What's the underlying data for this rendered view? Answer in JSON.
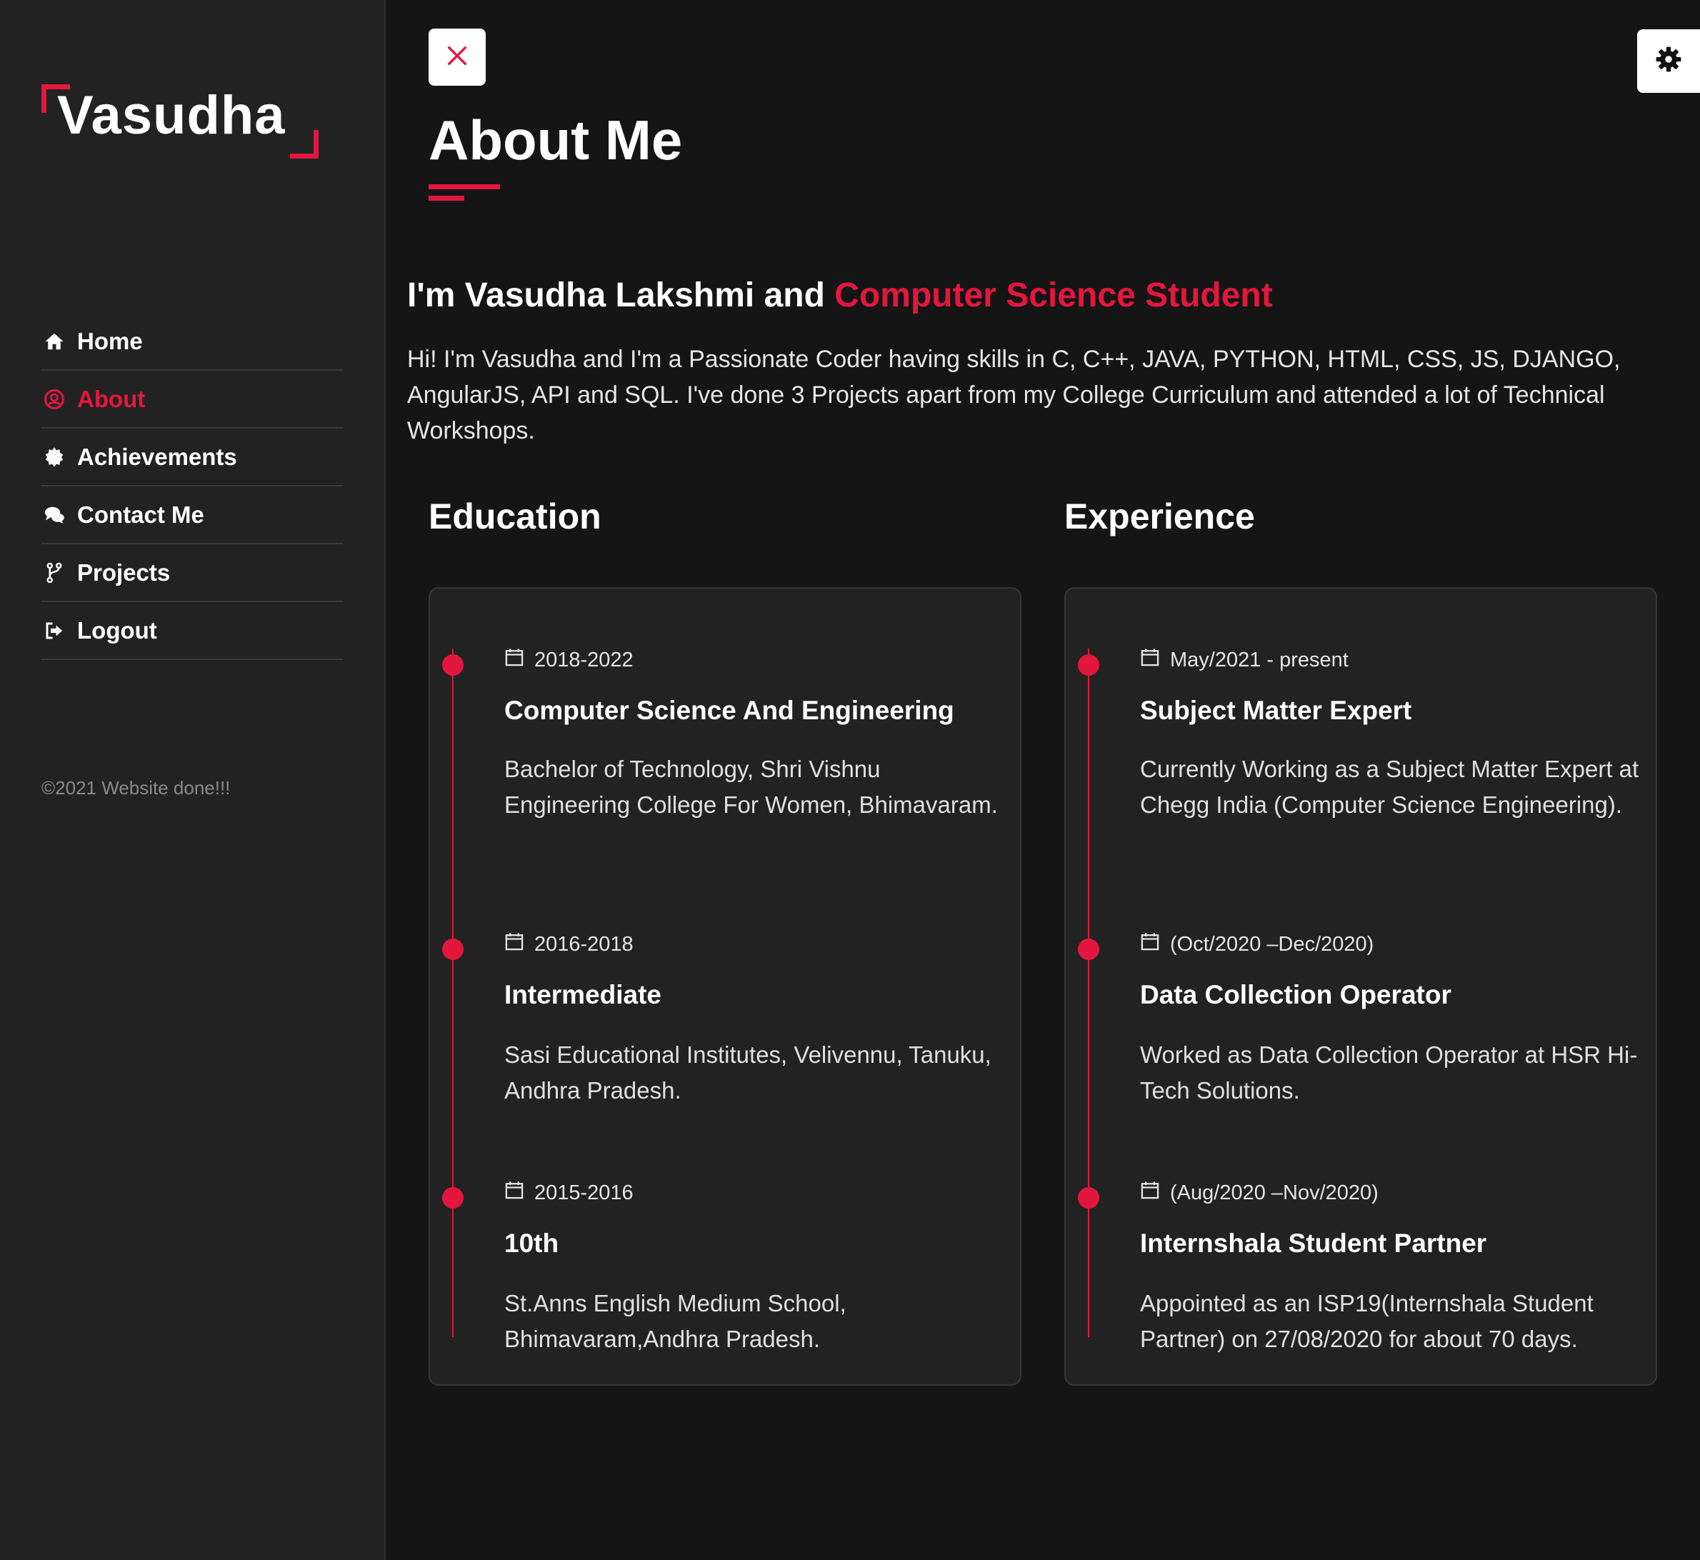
{
  "sidebar": {
    "logo": "Vasudha",
    "nav": [
      {
        "label": "Home",
        "icon": "home-icon"
      },
      {
        "label": "About",
        "icon": "user-circle-icon",
        "active": true
      },
      {
        "label": "Achievements",
        "icon": "badge-icon"
      },
      {
        "label": "Contact Me",
        "icon": "chat-icon"
      },
      {
        "label": "Projects",
        "icon": "code-fork-icon"
      },
      {
        "label": "Logout",
        "icon": "sign-out-icon"
      }
    ],
    "copyright": "©2021 Website done!!!"
  },
  "header": {
    "close_icon": "close-icon",
    "settings_icon": "gear-icon",
    "title": "About Me"
  },
  "intro": {
    "heading_prefix": "I'm Vasudha Lakshmi and",
    "heading_accent": "Computer Science Student",
    "text": "Hi! I'm Vasudha and I'm a Passionate Coder having skills in C, C++, JAVA, PYTHON, HTML, CSS, JS, DJANGO, AngularJS, API and SQL. I've done 3 Projects apart from my College Curriculum and attended a lot of Technical Workshops."
  },
  "education": {
    "title": "Education",
    "items": [
      {
        "date": "2018-2022",
        "title": "Computer Science And Engineering",
        "desc": "Bachelor of Technology, Shri Vishnu Engineering College For Women, Bhimavaram."
      },
      {
        "date": "2016-2018",
        "title": "Intermediate",
        "desc": "Sasi Educational Institutes, Velivennu, Tanuku, Andhra Pradesh."
      },
      {
        "date": "2015-2016",
        "title": "10th",
        "desc": "St.Anns English Medium School, Bhimavaram,Andhra Pradesh."
      }
    ]
  },
  "experience": {
    "title": "Experience",
    "items": [
      {
        "date": "May/2021 - present",
        "title": "Subject Matter Expert",
        "desc": "Currently Working as a Subject Matter Expert at Chegg India (Computer Science Engineering)."
      },
      {
        "date": "(Oct/2020 –Dec/2020)",
        "title": "Data Collection Operator",
        "desc": "Worked as Data Collection Operator at HSR Hi-Tech Solutions."
      },
      {
        "date": "(Aug/2020 –Nov/2020)",
        "title": "Internshala Student Partner",
        "desc": "Appointed as an ISP19(Internshala Student Partner) on 27/08/2020 for about 70 days."
      }
    ]
  },
  "colors": {
    "accent": "#e3173e",
    "background": "#151515",
    "sidebar": "#222222",
    "card": "#222222"
  }
}
